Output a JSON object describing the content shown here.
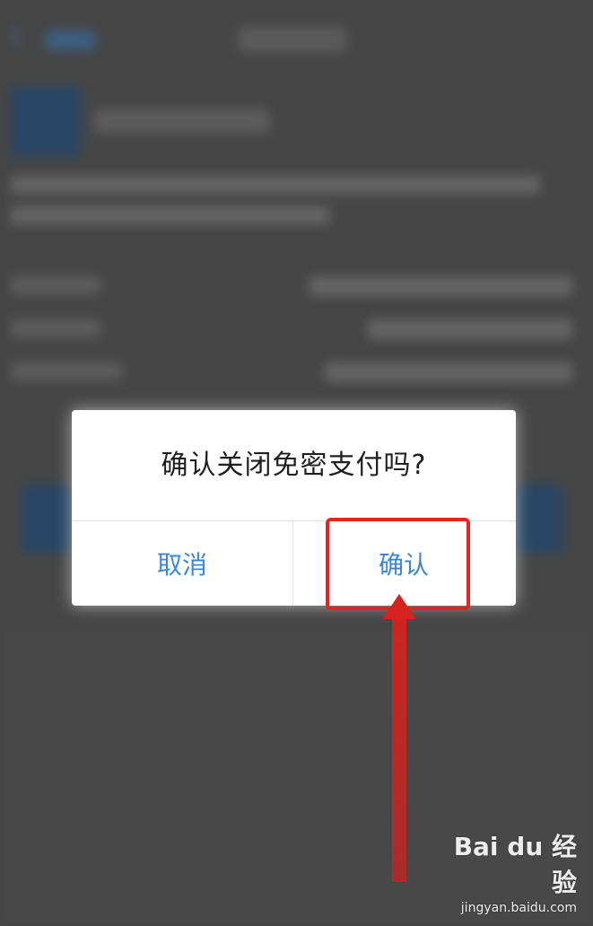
{
  "dialog": {
    "title": "确认关闭免密支付吗?",
    "cancel_label": "取消",
    "confirm_label": "确认"
  },
  "watermark": {
    "logo_text": "Bai du 经验",
    "url": "jingyan.baidu.com"
  },
  "colors": {
    "dialog_button_text": "#3b86d6",
    "highlight": "#e8231f",
    "overlay": "#595959",
    "background_blue": "#2a5a8a"
  },
  "icons": {
    "back": "chevron-left-icon",
    "app": "app-logo-icon",
    "arrow": "arrow-up-icon"
  }
}
